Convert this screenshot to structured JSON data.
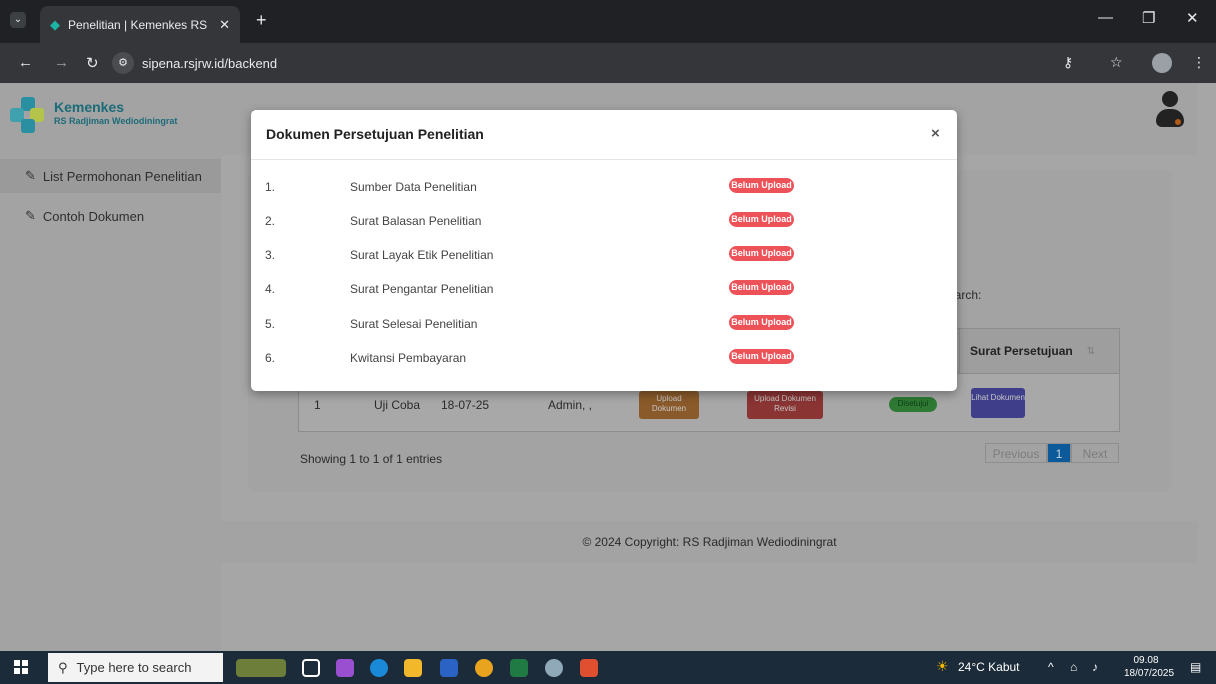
{
  "browser": {
    "tab_title": "Penelitian | Kemenkes RS Radjiman Wediodiningrat",
    "new_tab": "+",
    "url": "sipena.rsjrw.id/backend"
  },
  "sidebar": {
    "logo_main": "Kemenkes",
    "logo_sub": "RS Radjiman Wediodiningrat",
    "items": [
      {
        "label": "List Permohonan Penelitian",
        "icon": "edit-icon"
      },
      {
        "label": "Contoh Dokumen",
        "icon": "edit-icon"
      }
    ]
  },
  "background_table": {
    "search_label": "Search:",
    "columns": {
      "surat_persetujuan": "Surat Persetujuan"
    },
    "row": {
      "no": "1",
      "judul": "Uji Coba",
      "tanggal": "18-07-25",
      "peneliti": "Admin, ,",
      "upload_btn": "Upload Dokumen",
      "upload_revisi_btn": "Upload Dokumen Revisi",
      "status": "Disetujui",
      "lihat_btn": "Lihat Dokumen"
    },
    "showing": "Showing 1 to 1 of 1 entries",
    "pager": {
      "previous": "Previous",
      "current": "1",
      "next": "Next"
    }
  },
  "footer": {
    "copyright": "© 2024 Copyright: RS Radjiman Wediodiningrat"
  },
  "modal": {
    "title": "Dokumen Persetujuan Penelitian",
    "close": "×",
    "rows": [
      {
        "no": "1.",
        "name": "Sumber Data Penelitian",
        "status": "Belum Upload"
      },
      {
        "no": "2.",
        "name": "Surat Balasan Penelitian",
        "status": "Belum Upload"
      },
      {
        "no": "3.",
        "name": "Surat Layak Etik Penelitian",
        "status": "Belum Upload"
      },
      {
        "no": "4.",
        "name": "Surat Pengantar Penelitian",
        "status": "Belum Upload"
      },
      {
        "no": "5.",
        "name": "Surat Selesai Penelitian",
        "status": "Belum Upload"
      },
      {
        "no": "6.",
        "name": "Kwitansi Pembayaran",
        "status": "Belum Upload"
      }
    ]
  },
  "taskbar": {
    "search_placeholder": "Type here to search",
    "weather": "24°C Kabut",
    "time": "09.08",
    "date": "18/07/2025"
  },
  "colors": {
    "badge": "#ed5259",
    "brand_teal": "#1c6b79",
    "upload_btn": "#8a5a2a",
    "revisi_btn": "#8b3434",
    "approved": "#2e7a35",
    "lihat_btn": "#3f3e8a",
    "pager_active": "#0d5a9a"
  }
}
